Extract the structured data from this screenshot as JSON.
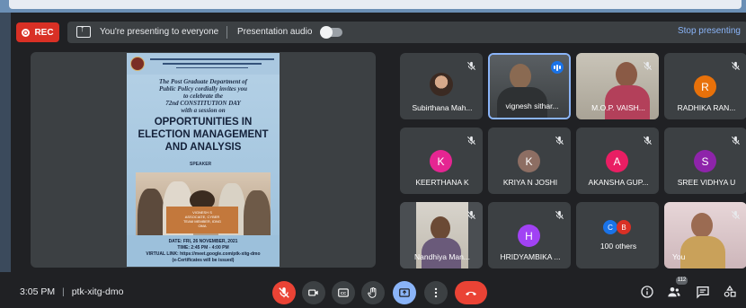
{
  "recording": {
    "label": "REC",
    "color": "#d93025"
  },
  "presenting_banner": {
    "message": "You're presenting to everyone",
    "audio_label": "Presentation audio",
    "audio_on": false,
    "stop_label": "Stop presenting"
  },
  "presentation": {
    "invite_lines": [
      "The Post Graduate Department of",
      "Public Policy cordially invites you",
      "to celebrate the",
      "72nd CONSTITUTION DAY",
      "with a session on"
    ],
    "title_lines": [
      "OPPORTUNITIES IN",
      "ELECTION MANAGEMENT",
      "AND ANALYSIS"
    ],
    "speaker_label": "SPEAKER",
    "speaker_lines": [
      "VIGNESH S",
      "ASSOCIATE, CYBER",
      "TEAM MEMBER, IDNG",
      "OMA"
    ],
    "date_line": "DATE: FRI, 26 NOVEMBER, 2021",
    "time_line": "TIME: 2:45 PM - 4:00 PM",
    "link_line": "VIRTUAL LINK: https://meet.google.com/ptk-xitg-dmo",
    "cert_line": "(e-Certificates will be issued)"
  },
  "participants": [
    {
      "name": "Subirthana Mah...",
      "type": "photo",
      "muted": true
    },
    {
      "name": "vignesh sithar...",
      "type": "video",
      "muted": false,
      "speaking": true
    },
    {
      "name": "M.O.P. VAISH...",
      "type": "video",
      "muted": true
    },
    {
      "name": "RADHIKA RAN...",
      "type": "initial",
      "initial": "R",
      "color": "#e8710a",
      "muted": true
    },
    {
      "name": "KEERTHANA K",
      "type": "initial",
      "initial": "K",
      "color": "#e52592",
      "muted": true
    },
    {
      "name": "KRIYA N JOSHI",
      "type": "initial",
      "initial": "K",
      "color": "#8d6e63",
      "muted": true
    },
    {
      "name": "AKANSHA GUP...",
      "type": "initial",
      "initial": "A",
      "color": "#e91e63",
      "muted": true
    },
    {
      "name": "SREE VIDHYA U",
      "type": "initial",
      "initial": "S",
      "color": "#8e24aa",
      "muted": true
    },
    {
      "name": "Nandhiya Man...",
      "type": "video",
      "muted": true
    },
    {
      "name": "HRIDYAMBIKA ...",
      "type": "initial",
      "initial": "H",
      "color": "#a142f4",
      "muted": true
    },
    {
      "name": "100 others",
      "type": "others",
      "initials": [
        "C",
        "B"
      ],
      "colors": [
        "#1a73e8",
        "#d93025"
      ]
    },
    {
      "name": "You",
      "type": "video",
      "muted": true
    }
  ],
  "bottom_bar": {
    "time": "3:05 PM",
    "separator": "|",
    "meeting_code": "ptk-xitg-dmo",
    "participant_count": "112",
    "controls": [
      "mic-off",
      "camera",
      "captions",
      "raise-hand",
      "present",
      "more-options",
      "leave-call"
    ],
    "right_icons": [
      "info",
      "people",
      "chat",
      "activities"
    ]
  },
  "colors": {
    "accent": "#8ab4f8",
    "danger": "#ea4335",
    "surface": "#3c4043",
    "background": "#202124"
  }
}
